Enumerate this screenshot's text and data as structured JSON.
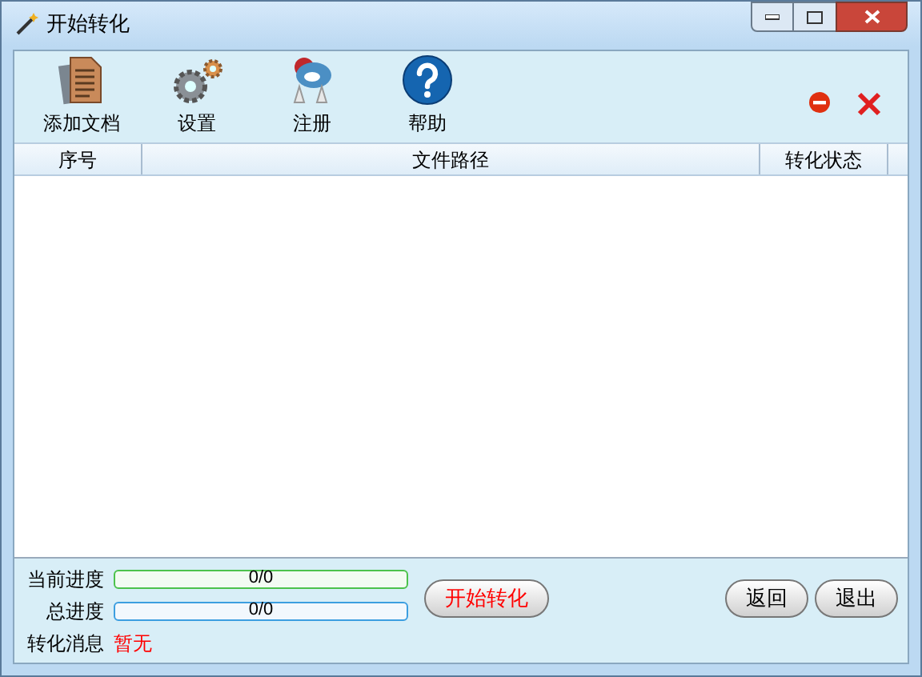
{
  "window": {
    "title": "开始转化"
  },
  "toolbar": [
    {
      "kind": "document",
      "label": "添加文档"
    },
    {
      "kind": "gear",
      "label": "设置"
    },
    {
      "kind": "register",
      "label": "注册"
    },
    {
      "kind": "help",
      "label": "帮助"
    }
  ],
  "table": {
    "columns": [
      "序号",
      "文件路径",
      "转化状态"
    ]
  },
  "progress": [
    {
      "label": "当前进度",
      "reading": "0/0",
      "level": 0,
      "kind": "green"
    },
    {
      "label": "总进度",
      "reading": "0/0",
      "level": 0,
      "kind": "blue"
    }
  ],
  "message": {
    "label": "转化消息",
    "value": "暂无"
  },
  "start_button": "开始转化",
  "buttons": [
    "返回",
    "退出"
  ]
}
